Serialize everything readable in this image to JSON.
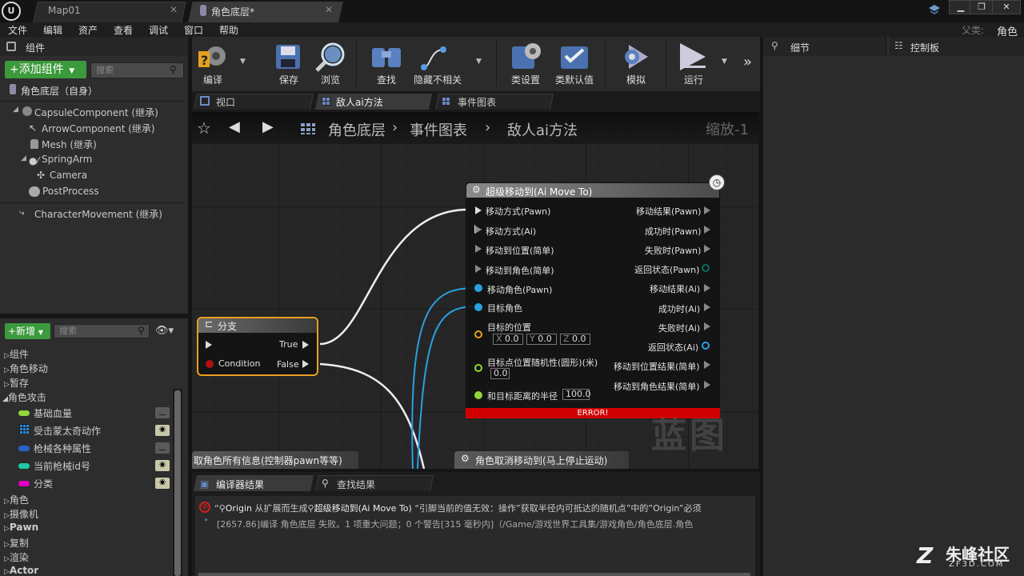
{
  "titlebar": {
    "logo": "U",
    "tabs": [
      {
        "label": "Map01"
      },
      {
        "label": "角色底层*"
      }
    ],
    "parent_label": "父类:",
    "parent_value": "角色"
  },
  "menu": [
    "文件",
    "编辑",
    "资产",
    "查看",
    "调试",
    "窗口",
    "帮助"
  ],
  "components_panel": {
    "title": "组件",
    "add_button": "+添加组件",
    "search_placeholder": "搜索",
    "root": "角色底层（自身）",
    "items": [
      {
        "label": "CapsuleComponent (继承)"
      },
      {
        "label": "ArrowComponent (继承)"
      },
      {
        "label": "Mesh (继承)"
      },
      {
        "label": "SpringArm"
      },
      {
        "label": "Camera"
      },
      {
        "label": "PostProcess"
      },
      {
        "label": "CharacterMovement (继承)"
      }
    ]
  },
  "mybp_panel": {
    "add_button": "+新增",
    "search_placeholder": "搜索",
    "categories": [
      "组件",
      "角色移动",
      "暂存",
      "角色攻击"
    ],
    "variables": [
      {
        "label": "基础血量",
        "color": "#8fd63a",
        "eye": false
      },
      {
        "label": "受击蒙太奇动作",
        "color": "#2a8ad8",
        "eye": true
      },
      {
        "label": "枪械各种属性",
        "color": "#2b63c9",
        "eye": false
      },
      {
        "label": "当前枪械id号",
        "color": "#1fc9a8",
        "eye": true
      },
      {
        "label": "分类",
        "color": "#e000c8",
        "eye": true
      }
    ],
    "more_categories": [
      "角色",
      "摄像机",
      "Pawn",
      "复制",
      "渲染",
      "Actor"
    ]
  },
  "toolbar": {
    "buttons": [
      {
        "label": "编译"
      },
      {
        "label": "保存"
      },
      {
        "label": "浏览"
      },
      {
        "label": "查找"
      },
      {
        "label": "隐藏不相关"
      },
      {
        "label": "类设置"
      },
      {
        "label": "类默认值"
      },
      {
        "label": "模拟"
      },
      {
        "label": "运行"
      }
    ]
  },
  "doc_tabs": [
    {
      "label": "视口"
    },
    {
      "label": "敌人ai方法"
    },
    {
      "label": "事件图表"
    }
  ],
  "breadcrumb": {
    "root": "角色底层",
    "part1": "事件图表",
    "part2": "敌人ai方法",
    "zoom": "缩放-1"
  },
  "branch_node": {
    "title": "分支",
    "true_label": "True",
    "false_label": "False",
    "condition_label": "Condition"
  },
  "move_node": {
    "title": "超级移动到(Ai Move To)",
    "inputs": [
      "移动方式(Pawn)",
      "移动方式(Ai)",
      "移动到位置(简单)",
      "移动到角色(简单)",
      "移动角色(Pawn)",
      "目标角色",
      "目标的位置",
      "目标点位置随机性(圆形)(米)",
      "和目标距离的半径"
    ],
    "outputs": [
      "移动结果(Pawn)",
      "成功时(Pawn)",
      "失败时(Pawn)",
      "返回状态(Pawn)",
      "移动结果(Ai)",
      "成功时(Ai)",
      "失败时(Ai)",
      "返回状态(Ai)",
      "移动到位置结果(简单)",
      "移动到角色结果(简单)"
    ],
    "vector": {
      "x_label": "X",
      "x": "0.0",
      "y_label": "Y",
      "y": "0.0",
      "z_label": "Z",
      "z": "0.0"
    },
    "random_value": "0.0",
    "radius_value": "100.0",
    "error": "ERROR!"
  },
  "bottom_nodes": {
    "left": "取角色所有信息(控制器pawn等等)",
    "right": "角色取消移动到(马上停止运动)"
  },
  "watermark_graph": "蓝图",
  "right_panels": {
    "details": "细节",
    "control": "控制板"
  },
  "results_tabs": {
    "compiler": "编译器结果",
    "find": "查找结果"
  },
  "log": {
    "line1_prefix": "“",
    "line1_origin": "Origin",
    "line1_mid": "从扩展而生成",
    "line1_node": "超级移动到(Ai Move To)",
    "line1_rest": "“引脚当前的值无效：操作”获取半径内可抵达的随机点”中的”Origin”必须",
    "line2": "[2657.86]编译 角色底层 失败。1 项重大问题；0 个警告[315 毫秒内]（/Game/游戏世界工具集/游戏角色/角色底层.角色"
  },
  "site_watermark": {
    "brand": "朱峰社区",
    "url": "ZF3D.COM"
  }
}
